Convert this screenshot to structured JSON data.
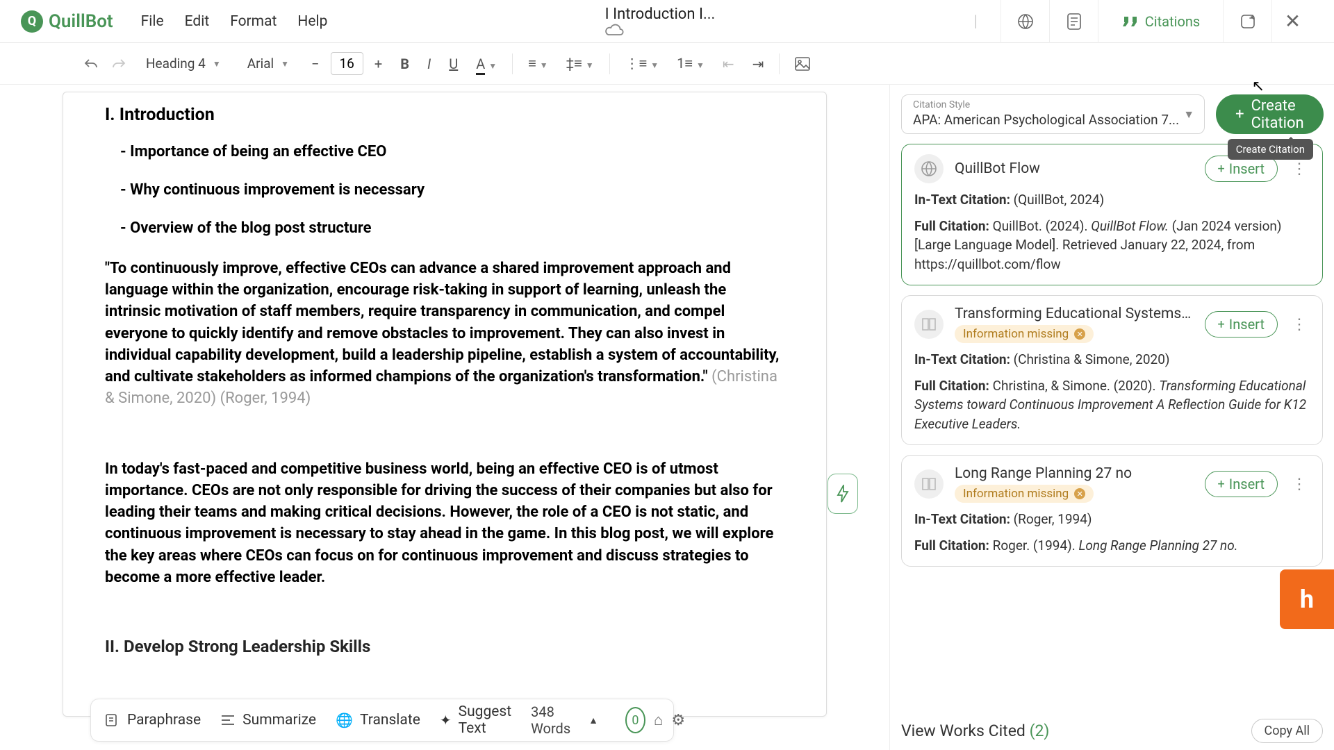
{
  "brand": "QuillBot",
  "menu": {
    "file": "File",
    "edit": "Edit",
    "format": "Format",
    "help": "Help"
  },
  "doc_title": "I Introduction I...",
  "right_nav": {
    "citations": "Citations"
  },
  "toolbar": {
    "heading": "Heading 4",
    "font": "Arial",
    "font_size": "16"
  },
  "document": {
    "h1": "I. Introduction",
    "b1": "- Importance of being an effective CEO",
    "b2": "- Why continuous improvement is necessary",
    "b3": "- Overview of the blog post structure",
    "quote": " \"To continuously improve, effective CEOs can advance a shared improvement approach and language within the organization, encourage risk-taking in support of learning, unleash the intrinsic motivation of staff members, require transparency in communication, and compel everyone to quickly identify and remove obstacles to improvement. They can also invest in individual capability development, build a leadership pipeline, establish a system of accountability, and cultivate stakeholders as informed champions of the organization's transformation.\" ",
    "quote_cite": "(Christina & Simone, 2020) (Roger, 1994)",
    "body": "In today's fast-paced and competitive business world, being an effective CEO is of utmost importance. CEOs are not only responsible for driving the success of their companies but also for leading their teams and making critical decisions. However, the role of a CEO is not static, and continuous improvement is necessary to stay ahead in the game. In this blog post, we will explore the key areas where CEOs can focus on for continuous improvement and discuss strategies to become a more effective leader.",
    "h2": "II. Develop Strong Leadership Skills"
  },
  "bottom": {
    "paraphrase": "Paraphrase",
    "summarize": "Summarize",
    "translate": "Translate",
    "suggest": "Suggest Text",
    "words": "348 Words",
    "badge": "0"
  },
  "panel": {
    "style_label": "Citation Style",
    "style_value": "APA: American Psychological Association 7...",
    "create": "Create Citation",
    "tooltip": "Create Citation",
    "insert": "Insert",
    "missing": "Information missing",
    "intext_label": "In-Text Citation:",
    "full_label": "Full Citation:",
    "cards": [
      {
        "title": "QuillBot Flow",
        "intext": "(QuillBot, 2024)",
        "full_plain1": "QuillBot. (2024). ",
        "full_ital": "QuillBot Flow.",
        "full_plain2": " (Jan 2024 version) [Large Language Model]. Retrieved January 22, 2024, from https://quillbot.com/flow"
      },
      {
        "title": "Transforming Educational Systems tow...",
        "intext": "(Christina & Simone, 2020)",
        "full_plain1": "Christina, & Simone. (2020). ",
        "full_ital": "Transforming Educational Systems toward Continuous Improvement A Reflection Guide for K12 Executive Leaders.",
        "full_plain2": ""
      },
      {
        "title": "Long Range Planning 27 no",
        "intext": "(Roger, 1994)",
        "full_plain1": "Roger. (1994). ",
        "full_ital": "Long Range Planning 27 no.",
        "full_plain2": ""
      }
    ],
    "footer_label": "View Works Cited ",
    "footer_count": "(2)",
    "copy_all": "Copy All"
  }
}
